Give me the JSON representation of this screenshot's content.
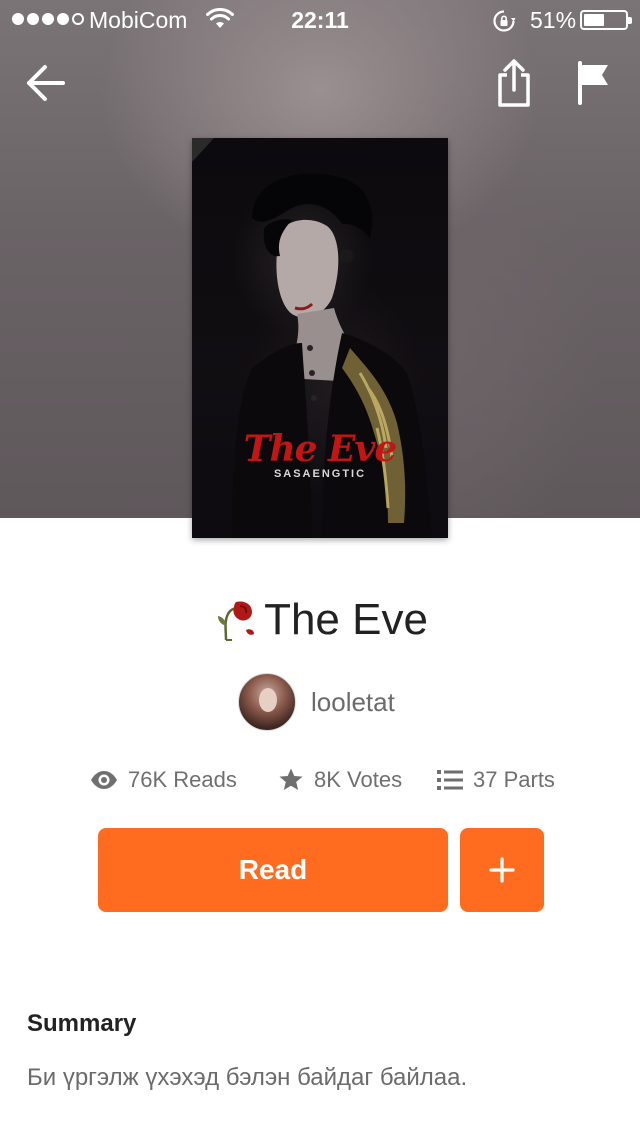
{
  "status_bar": {
    "carrier": "MobiCom",
    "time": "22:11",
    "battery": "51%",
    "battery_level": 0.51,
    "signal_bars": 4,
    "icons": [
      "signal-icon",
      "wifi-icon",
      "rotation-lock-icon",
      "battery-icon"
    ]
  },
  "nav": {
    "icons": [
      "back-arrow-icon",
      "share-icon",
      "flag-icon"
    ]
  },
  "cover": {
    "title": "The Eve",
    "author": "SASAENGTIC"
  },
  "story": {
    "title_emoji_icon": "wilted-rose-icon",
    "title": "The Eve",
    "author": "looletat"
  },
  "stats": {
    "reads": "76K Reads",
    "votes": "8K Votes",
    "parts": "37 Parts",
    "icons": [
      "eye-icon",
      "star-icon",
      "list-icon"
    ]
  },
  "actions": {
    "read_label": "Read",
    "add_label": "+"
  },
  "summary": {
    "heading": "Summary",
    "text": "Би үргэлж үхэхэд бэлэн байдаг байлаа."
  },
  "colors": {
    "accent": "#ff6c1f",
    "cover_title": "#c41515"
  }
}
